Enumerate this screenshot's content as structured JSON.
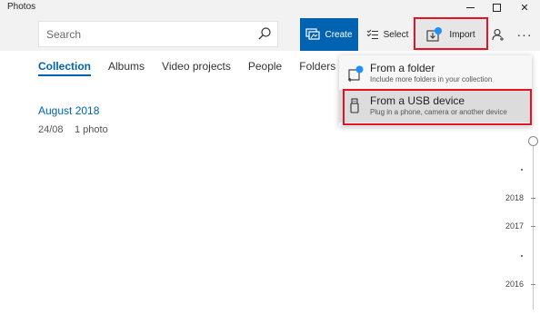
{
  "window": {
    "title": "Photos"
  },
  "toolbar": {
    "search_placeholder": "Search",
    "create_label": "Create",
    "select_label": "Select",
    "import_label": "Import"
  },
  "nav": {
    "tabs": [
      {
        "label": "Collection",
        "active": true
      },
      {
        "label": "Albums"
      },
      {
        "label": "Video projects"
      },
      {
        "label": "People"
      },
      {
        "label": "Folders"
      }
    ]
  },
  "collection": {
    "group_title": "August 2018",
    "date": "24/08",
    "count": "1 photo"
  },
  "import_menu": {
    "items": [
      {
        "title": "From a folder",
        "subtitle": "Include more folders in your collection",
        "icon": "folder-add-icon"
      },
      {
        "title": "From a USB device",
        "subtitle": "Plug in a phone, camera or another device",
        "icon": "usb-icon",
        "highlighted": true
      }
    ]
  },
  "timeline": {
    "years": [
      "2018",
      "2017",
      "2016"
    ]
  },
  "colors": {
    "accent": "#0063b1",
    "highlight_box": "#e81123",
    "notification_dot": "#1e90ff"
  }
}
